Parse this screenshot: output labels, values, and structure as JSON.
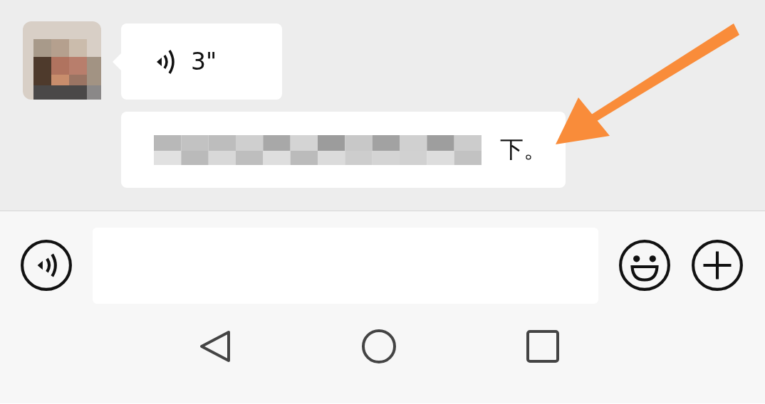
{
  "messages": [
    {
      "kind": "voice",
      "duration": "3\""
    },
    {
      "kind": "text",
      "text": "下。",
      "redacted": true
    }
  ]
}
